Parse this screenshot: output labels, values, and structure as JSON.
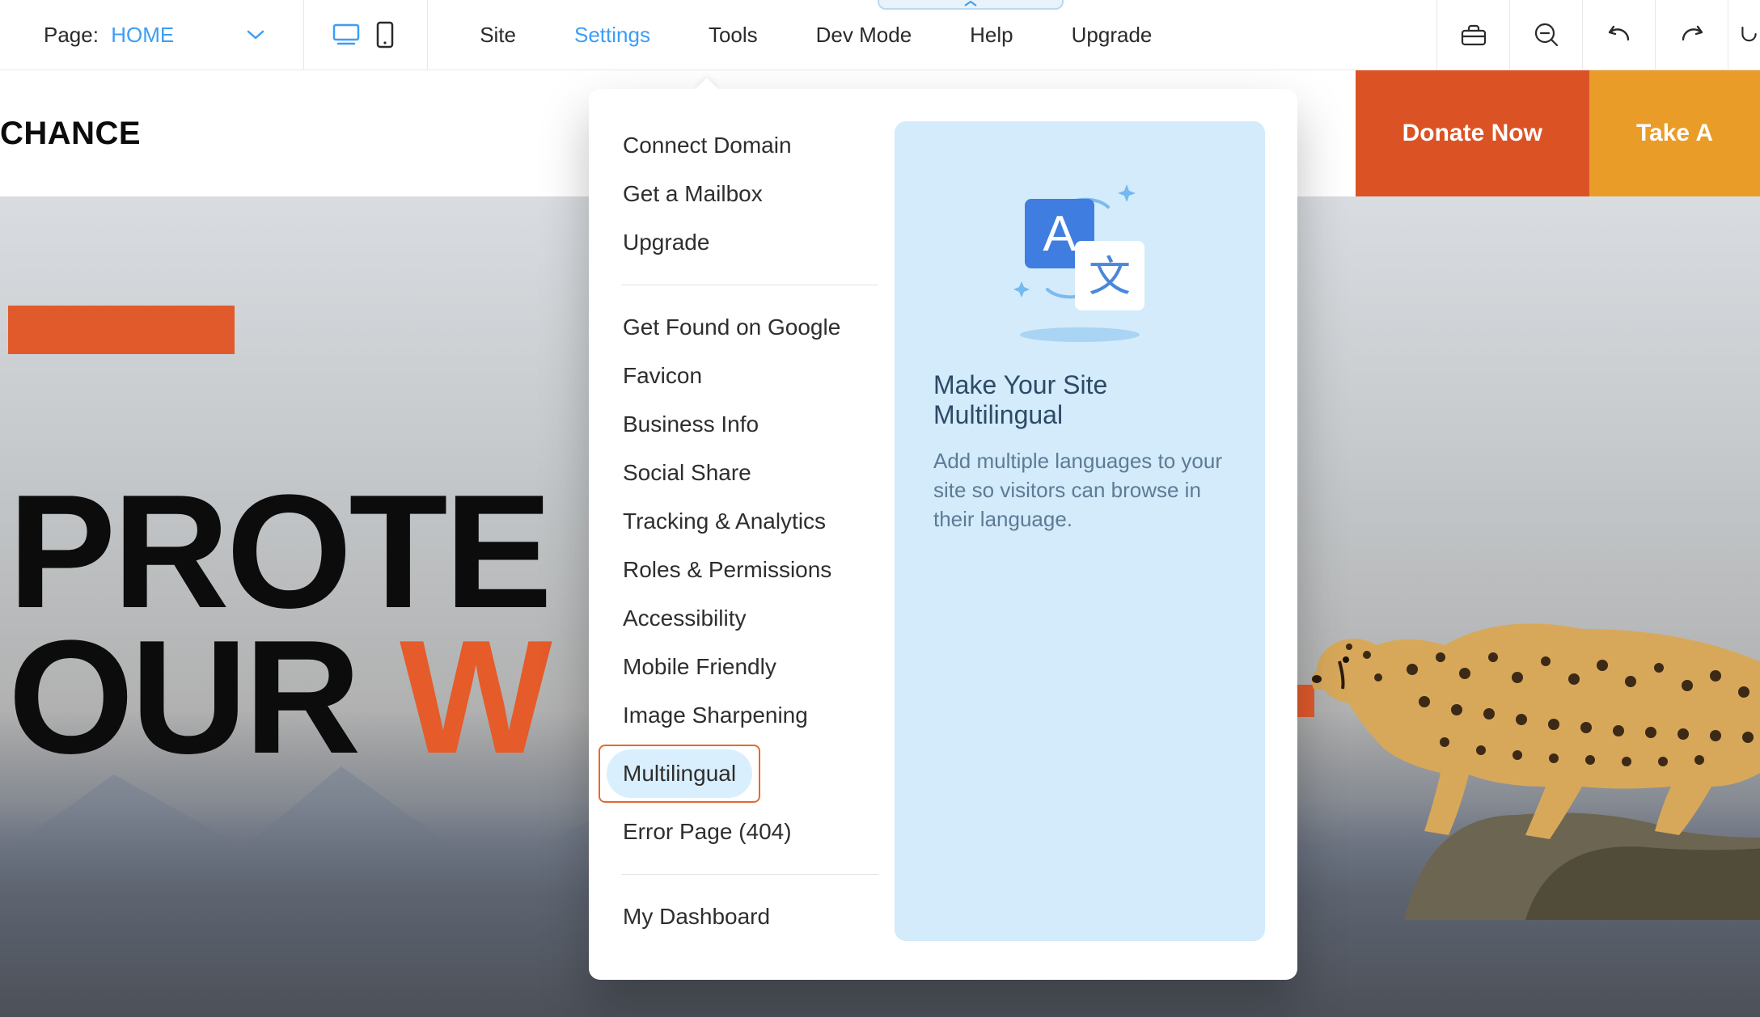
{
  "topbar": {
    "page_label": "Page:",
    "page_value": "HOME",
    "menu": [
      {
        "id": "site",
        "label": "Site"
      },
      {
        "id": "settings",
        "label": "Settings",
        "active": true
      },
      {
        "id": "tools",
        "label": "Tools"
      },
      {
        "id": "devmode",
        "label": "Dev Mode"
      },
      {
        "id": "help",
        "label": "Help"
      },
      {
        "id": "upgrade",
        "label": "Upgrade"
      }
    ]
  },
  "site_header": {
    "brand": "CHANCE",
    "cta_primary": "Donate Now",
    "cta_secondary": "Take A"
  },
  "hero": {
    "headline_line1": "PROTE",
    "headline_line2_a": "OUR ",
    "headline_line2_b": "W"
  },
  "settings_dropdown": {
    "group1": [
      "Connect Domain",
      "Get a Mailbox",
      "Upgrade"
    ],
    "group2": [
      "Get Found on Google",
      "Favicon",
      "Business Info",
      "Social Share",
      "Tracking & Analytics",
      "Roles & Permissions",
      "Accessibility",
      "Mobile Friendly",
      "Image Sharpening",
      "Multilingual",
      "Error Page (404)"
    ],
    "group3": [
      "My Dashboard"
    ],
    "highlighted_item": "Multilingual",
    "preview": {
      "title": "Make Your Site Multilingual",
      "description": "Add multiple languages to your site so visitors can browse in their language."
    }
  }
}
